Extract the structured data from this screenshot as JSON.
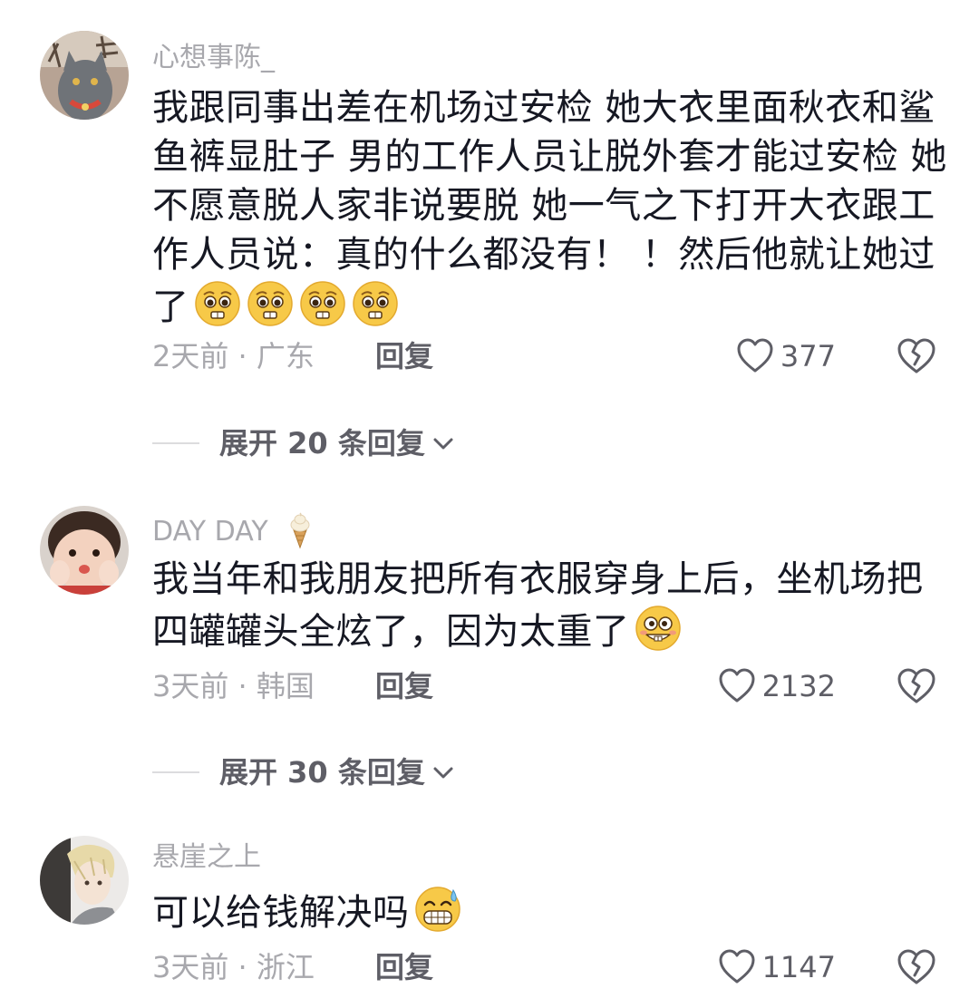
{
  "comments": [
    {
      "username": "心想事陈_",
      "text": "我跟同事出差在机场过安检 她大衣里面秋衣和鲨鱼裤显肚子 男的工作人员让脱外套才能过安检 她不愿意脱人家非说要脱 她一气之下打开大衣跟工作人员说：真的什么都没有！ ！然后他就让她过了",
      "emoji": [
        "pleading-face",
        "pleading-face",
        "pleading-face",
        "pleading-face"
      ],
      "time_location": "2天前 · 广东",
      "reply_label": "回复",
      "like_count": "377",
      "expand_label": "展开 20 条回复"
    },
    {
      "username": "DAY DAY",
      "username_icon": "ice-cream-icon",
      "text": "我当年和我朋友把所有衣服穿身上后，坐机场把四罐罐头全炫了，因为太重了",
      "emoji": [
        "goofy-grin-face"
      ],
      "time_location": "3天前 · 韩国",
      "reply_label": "回复",
      "like_count": "2132",
      "expand_label": "展开 30 条回复"
    },
    {
      "username": "悬崖之上",
      "text": "可以给钱解决吗",
      "emoji": [
        "grinning-sweat-face"
      ],
      "time_location": "3天前 · 浙江",
      "reply_label": "回复",
      "like_count": "1147"
    }
  ],
  "avatars": {
    "c1": "cat-avatar",
    "c2": "baby-avatar",
    "c3": "anime-boy-avatar"
  },
  "colors": {
    "text_primary": "#161823",
    "text_secondary": "#a8a8ad",
    "text_action": "#5e5e66",
    "emoji_yellow": "#f7c948"
  }
}
